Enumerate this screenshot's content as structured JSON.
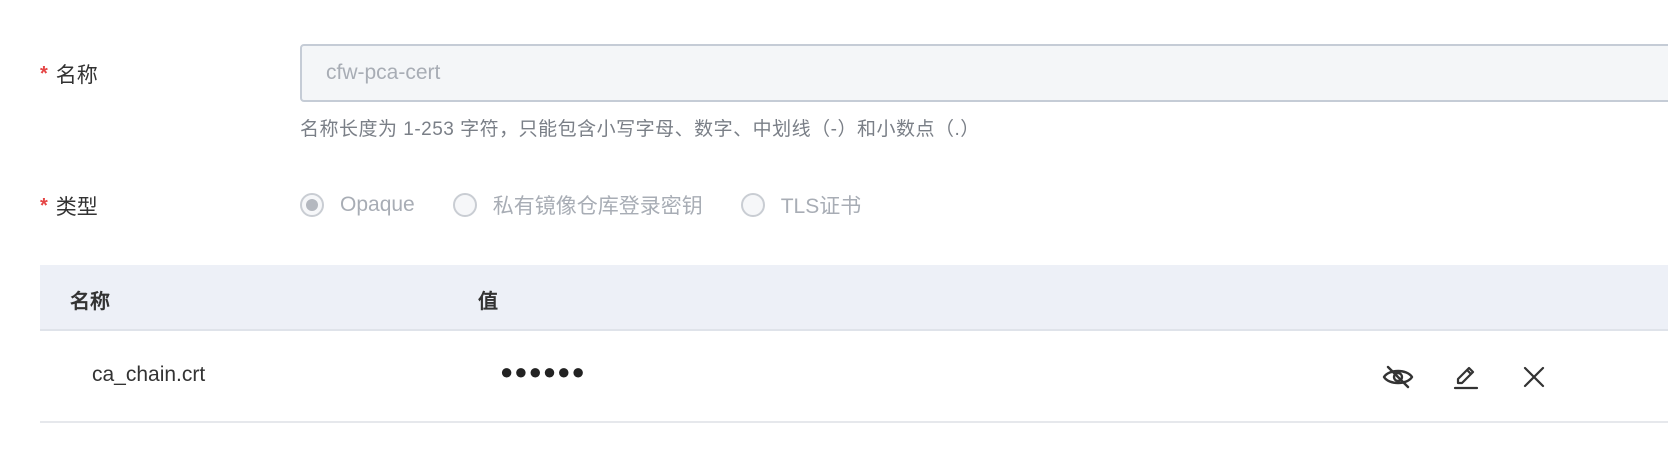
{
  "form": {
    "name": {
      "label": "名称",
      "required_mark": "*",
      "placeholder": "cfw-pca-cert",
      "hint": "名称长度为 1-253 字符，只能包含小写字母、数字、中划线（-）和小数点（.）"
    },
    "type": {
      "label": "类型",
      "required_mark": "*",
      "options": [
        {
          "label": "Opaque",
          "selected": true
        },
        {
          "label": "私有镜像仓库登录密钥",
          "selected": false
        },
        {
          "label": "TLS证书",
          "selected": false
        }
      ]
    }
  },
  "table": {
    "columns": {
      "name": "名称",
      "value": "值"
    },
    "rows": [
      {
        "name": "ca_chain.crt",
        "value": "●●●●●●"
      }
    ]
  },
  "icons": {
    "hide": "eye-off-icon",
    "edit": "pencil-icon",
    "delete": "close-icon"
  },
  "colors": {
    "required": "#e54545",
    "header_bg": "#edf0f7",
    "input_bg": "#f4f6f8"
  }
}
